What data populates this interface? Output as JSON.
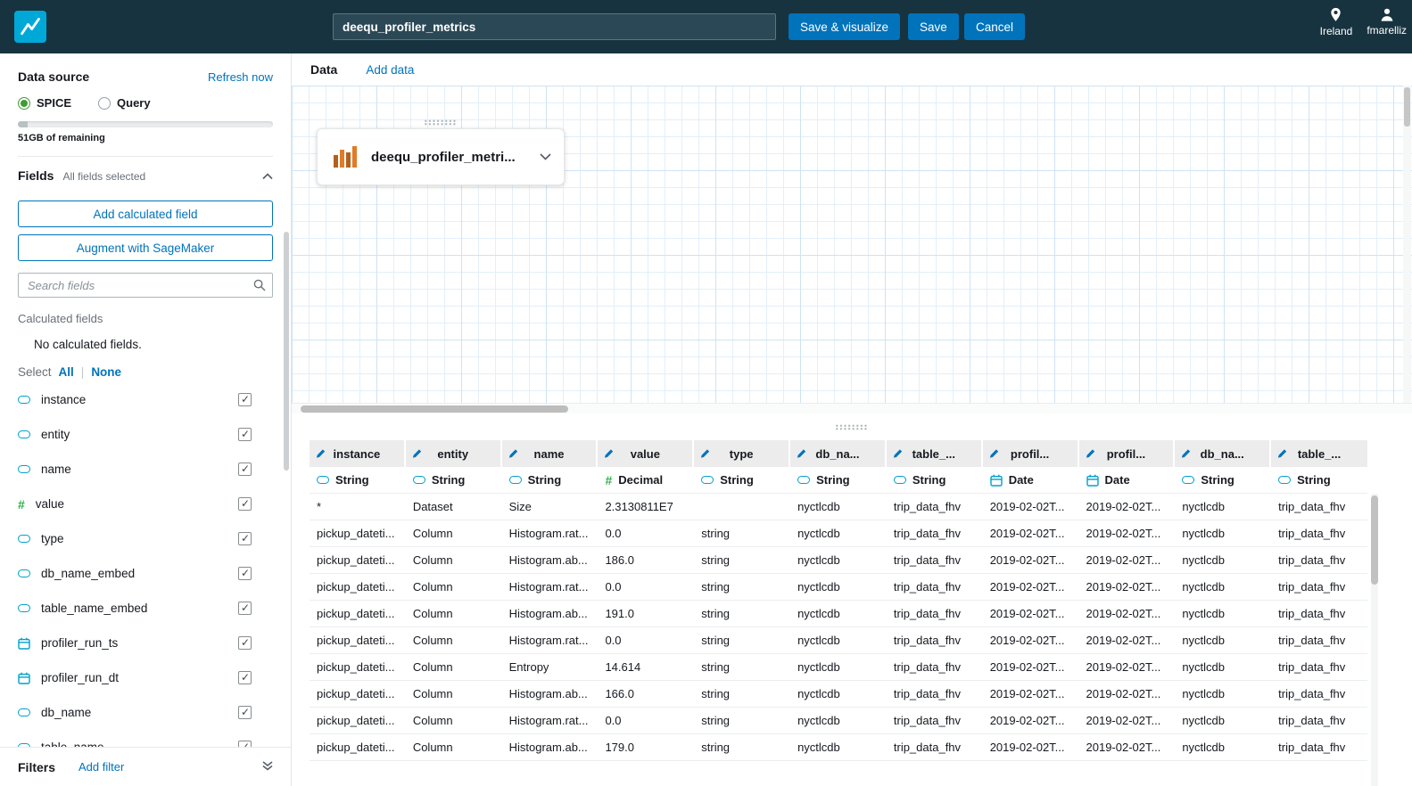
{
  "topbar": {
    "dataset_name": "deequ_profiler_metrics",
    "save_visualize": "Save & visualize",
    "save": "Save",
    "cancel": "Cancel",
    "region": "Ireland",
    "username": "fmarelliz"
  },
  "sidebar": {
    "data_source_label": "Data source",
    "refresh_link": "Refresh now",
    "spice_label": "SPICE",
    "query_label": "Query",
    "capacity_text": "51GB of remaining",
    "fields_label": "Fields",
    "fields_sub": "All fields selected",
    "add_calc_button": "Add calculated field",
    "sagemaker_button": "Augment with SageMaker",
    "search_placeholder": "Search fields",
    "calculated_fields_label": "Calculated fields",
    "no_calc_text": "No calculated fields.",
    "select_label": "Select",
    "select_all": "All",
    "select_none": "None",
    "fields": [
      {
        "name": "instance",
        "type": "string",
        "checked": true
      },
      {
        "name": "entity",
        "type": "string",
        "checked": true
      },
      {
        "name": "name",
        "type": "string",
        "checked": true
      },
      {
        "name": "value",
        "type": "decimal",
        "checked": true
      },
      {
        "name": "type",
        "type": "string",
        "checked": true
      },
      {
        "name": "db_name_embed",
        "type": "string",
        "checked": true
      },
      {
        "name": "table_name_embed",
        "type": "string",
        "checked": true
      },
      {
        "name": "profiler_run_ts",
        "type": "date",
        "checked": true
      },
      {
        "name": "profiler_run_dt",
        "type": "date",
        "checked": true
      },
      {
        "name": "db_name",
        "type": "string",
        "checked": true
      },
      {
        "name": "table_name",
        "type": "string",
        "checked": true
      }
    ],
    "filters_label": "Filters",
    "add_filter_link": "Add filter"
  },
  "main": {
    "tab_data": "Data",
    "tab_add_data": "Add data",
    "dataset_card_label": "deequ_profiler_metri..."
  },
  "table": {
    "columns": [
      {
        "label": "instance",
        "type": "string",
        "type_label": "String"
      },
      {
        "label": "entity",
        "type": "string",
        "type_label": "String"
      },
      {
        "label": "name",
        "type": "string",
        "type_label": "String"
      },
      {
        "label": "value",
        "type": "decimal",
        "type_label": "Decimal"
      },
      {
        "label": "type",
        "type": "string",
        "type_label": "String"
      },
      {
        "label": "db_na...",
        "type": "string",
        "type_label": "String"
      },
      {
        "label": "table_...",
        "type": "string",
        "type_label": "String"
      },
      {
        "label": "profil...",
        "type": "date",
        "type_label": "Date"
      },
      {
        "label": "profil...",
        "type": "date",
        "type_label": "Date"
      },
      {
        "label": "db_na...",
        "type": "string",
        "type_label": "String"
      },
      {
        "label": "table_...",
        "type": "string",
        "type_label": "String"
      }
    ],
    "rows": [
      [
        "*",
        "Dataset",
        "Size",
        "2.3130811E7",
        "",
        "nyctlcdb",
        "trip_data_fhv",
        "2019-02-02T...",
        "2019-02-02T...",
        "nyctlcdb",
        "trip_data_fhv"
      ],
      [
        "pickup_dateti...",
        "Column",
        "Histogram.rat...",
        "0.0",
        "string",
        "nyctlcdb",
        "trip_data_fhv",
        "2019-02-02T...",
        "2019-02-02T...",
        "nyctlcdb",
        "trip_data_fhv"
      ],
      [
        "pickup_dateti...",
        "Column",
        "Histogram.ab...",
        "186.0",
        "string",
        "nyctlcdb",
        "trip_data_fhv",
        "2019-02-02T...",
        "2019-02-02T...",
        "nyctlcdb",
        "trip_data_fhv"
      ],
      [
        "pickup_dateti...",
        "Column",
        "Histogram.rat...",
        "0.0",
        "string",
        "nyctlcdb",
        "trip_data_fhv",
        "2019-02-02T...",
        "2019-02-02T...",
        "nyctlcdb",
        "trip_data_fhv"
      ],
      [
        "pickup_dateti...",
        "Column",
        "Histogram.ab...",
        "191.0",
        "string",
        "nyctlcdb",
        "trip_data_fhv",
        "2019-02-02T...",
        "2019-02-02T...",
        "nyctlcdb",
        "trip_data_fhv"
      ],
      [
        "pickup_dateti...",
        "Column",
        "Histogram.rat...",
        "0.0",
        "string",
        "nyctlcdb",
        "trip_data_fhv",
        "2019-02-02T...",
        "2019-02-02T...",
        "nyctlcdb",
        "trip_data_fhv"
      ],
      [
        "pickup_dateti...",
        "Column",
        "Entropy",
        "14.614",
        "string",
        "nyctlcdb",
        "trip_data_fhv",
        "2019-02-02T...",
        "2019-02-02T...",
        "nyctlcdb",
        "trip_data_fhv"
      ],
      [
        "pickup_dateti...",
        "Column",
        "Histogram.ab...",
        "166.0",
        "string",
        "nyctlcdb",
        "trip_data_fhv",
        "2019-02-02T...",
        "2019-02-02T...",
        "nyctlcdb",
        "trip_data_fhv"
      ],
      [
        "pickup_dateti...",
        "Column",
        "Histogram.rat...",
        "0.0",
        "string",
        "nyctlcdb",
        "trip_data_fhv",
        "2019-02-02T...",
        "2019-02-02T...",
        "nyctlcdb",
        "trip_data_fhv"
      ],
      [
        "pickup_dateti...",
        "Column",
        "Histogram.ab...",
        "179.0",
        "string",
        "nyctlcdb",
        "trip_data_fhv",
        "2019-02-02T...",
        "2019-02-02T...",
        "nyctlcdb",
        "trip_data_fhv"
      ]
    ]
  },
  "icons": {
    "logo": "quicksight-logo",
    "region": "location-pin",
    "user": "person",
    "search": "magnifier",
    "edit": "pencil",
    "string_type": "pill",
    "decimal_type": "#",
    "date_type": "calendar",
    "dataset": "aws-dataset-bars",
    "card_chevron": "chevron-down",
    "fields_collapse": "chevron-up",
    "filters_collapse": "double-chevron-down"
  },
  "colors": {
    "topbar": "#17333f",
    "accent_blue": "#0073bb",
    "spice_green": "#3f9c35",
    "type_teal": "#00a1c9",
    "decimal_green": "#2db34a",
    "dataset_icon_orange": "#e07b27"
  }
}
